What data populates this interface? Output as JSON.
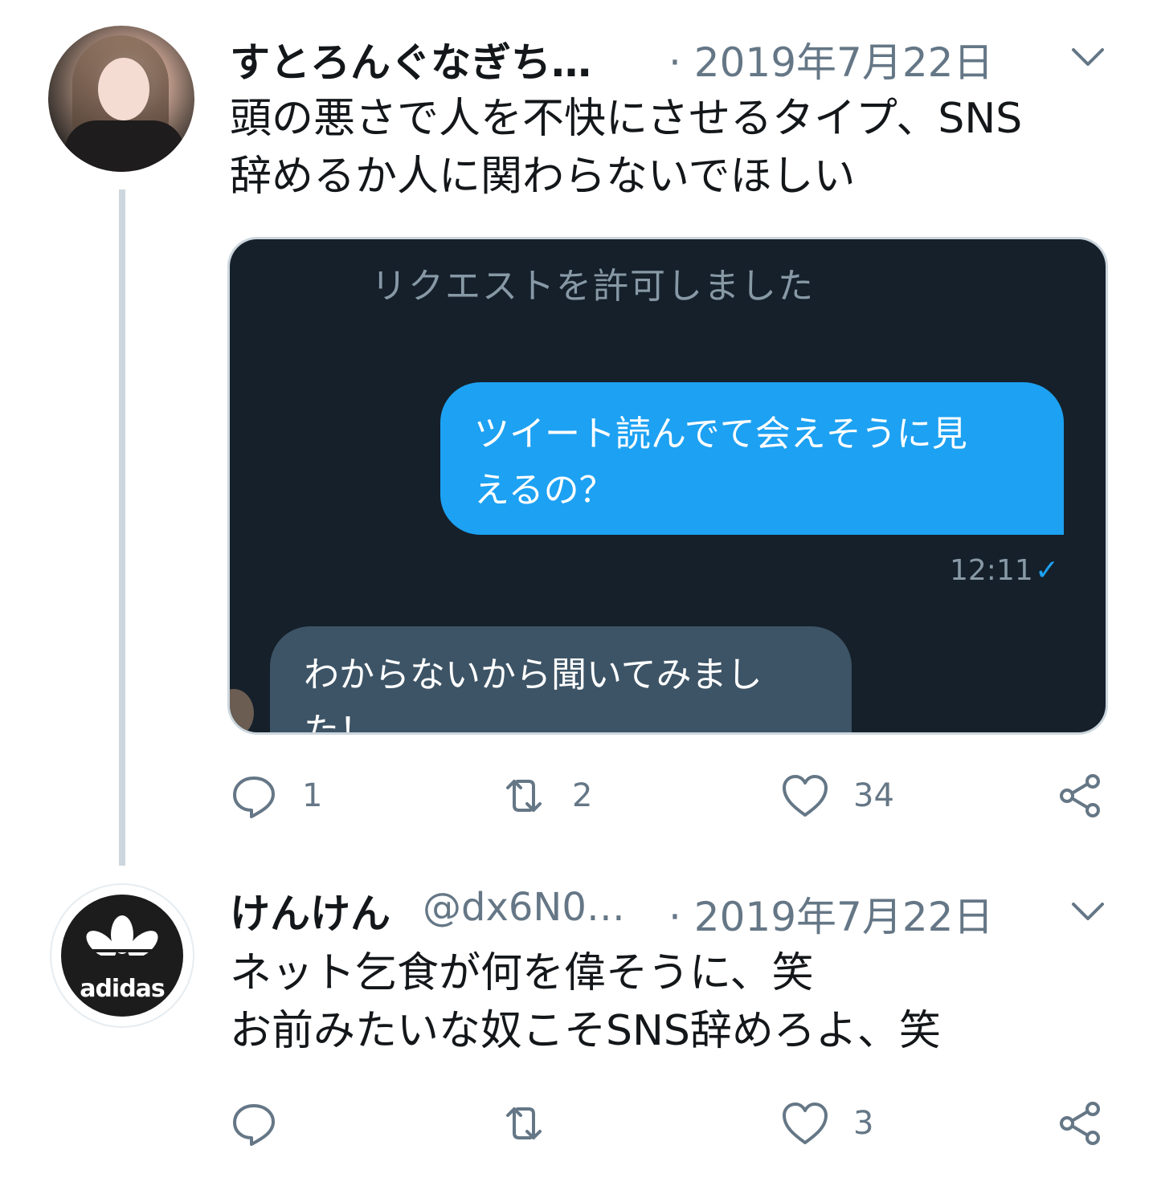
{
  "tweets": [
    {
      "name": "すとろんぐなぎち…",
      "handle": "",
      "date": "· 2019年7月22日",
      "text_lines": [
        "頭の悪さで人を不快にさせるタイプ、SNS",
        "辞めるか人に関わらないでほしい"
      ],
      "media": {
        "request_text": "リクエストを許可しました",
        "outgoing_lines": [
          "ツイート読んでて会えそうに見",
          "えるの？"
        ],
        "outgoing_time": "12:11",
        "outgoing_check": "✓",
        "incoming_lines": [
          "わからないから聞いてみまし",
          "た！"
        ]
      },
      "actions": {
        "reply_count": "1",
        "retweet_count": "2",
        "like_count": "34"
      }
    },
    {
      "name": "けんけん",
      "handle": "@dx6N0…",
      "date": "· 2019年7月22日",
      "text_lines": [
        "ネット乞食が何を偉そうに、笑",
        "お前みたいな奴こそSNS辞めろよ、笑"
      ],
      "avatar_logo_text": "adidas",
      "actions": {
        "reply_count": "",
        "retweet_count": "",
        "like_count": "3"
      }
    }
  ],
  "colors": {
    "accent": "#1da1f2",
    "secondary_text": "#657786",
    "media_bg": "#15202b",
    "incoming_bubble": "#3d5466"
  },
  "icons": [
    "reply-icon",
    "retweet-icon",
    "like-icon",
    "share-icon",
    "chevron-down-icon"
  ]
}
